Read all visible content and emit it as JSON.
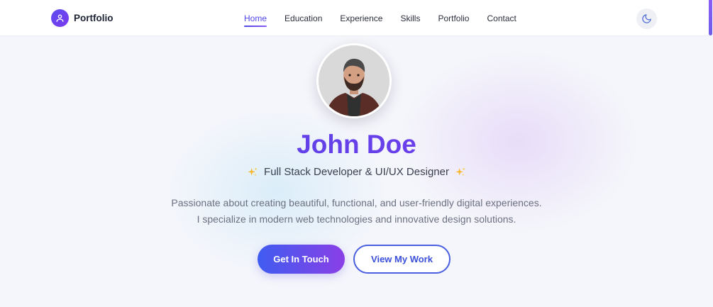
{
  "brand": {
    "name": "Portfolio",
    "logo_icon": "user-icon"
  },
  "nav": {
    "items": [
      {
        "label": "Home",
        "active": true
      },
      {
        "label": "Education",
        "active": false
      },
      {
        "label": "Experience",
        "active": false
      },
      {
        "label": "Skills",
        "active": false
      },
      {
        "label": "Portfolio",
        "active": false
      },
      {
        "label": "Contact",
        "active": false
      }
    ],
    "theme_toggle_icon": "moon-icon"
  },
  "hero": {
    "name": "John Doe",
    "tagline": "Full Stack Developer & UI/UX Designer",
    "sparkle_icon": "sparkles-icon",
    "bio_lines": [
      "Passionate about creating beautiful, functional, and user-friendly digital experiences.",
      "I specialize in modern web technologies and innovative design solutions."
    ],
    "primary_button": "Get In Touch",
    "secondary_button": "View My Work"
  },
  "colors": {
    "accent": "#4f46e5",
    "accent_purple": "#7c3aed",
    "text_dark": "#1d2333",
    "text_muted": "#6b7080",
    "background": "#f5f6fb"
  }
}
